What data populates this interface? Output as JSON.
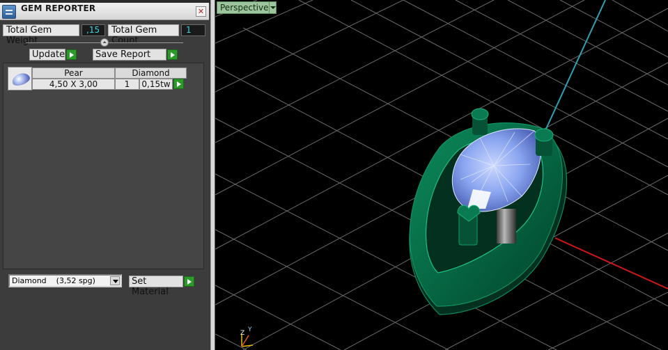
{
  "panel": {
    "title": "GEM REPORTER",
    "close_glyph": "✕",
    "total_gem_weight_label": "Total Gem Weight",
    "total_gem_weight_value": ",15",
    "total_gem_count_label": "Total Gem Count",
    "total_gem_count_value": "1",
    "divider_glyph": "⏶",
    "update_label": "Update",
    "save_report_label": "Save Report",
    "gem": {
      "shape": "Pear",
      "material": "Diamond",
      "size": "4,50 X 3,00",
      "count": "1",
      "weight": "0,15tw"
    },
    "material_select": {
      "name": "Diamond",
      "density": "(3,52 spg)"
    },
    "set_material_label": "Set Material"
  },
  "viewport": {
    "view_label": "Perspective",
    "axis_z": "Z",
    "axis_y": "Y"
  },
  "colors": {
    "gem_value_text": "#3fd7e3",
    "play_button": "#2b9a2b",
    "ring_green": "#0a6c4a",
    "gem_blue": "#8aa5f0",
    "grid": "#6a6a6a",
    "x_axis": "#d01818",
    "y_axis": "#2aa3b7"
  },
  "icons": [
    "gem-reporter-app-icon",
    "close-icon",
    "play-icon",
    "pear-gem-icon",
    "chevron-down-icon"
  ]
}
